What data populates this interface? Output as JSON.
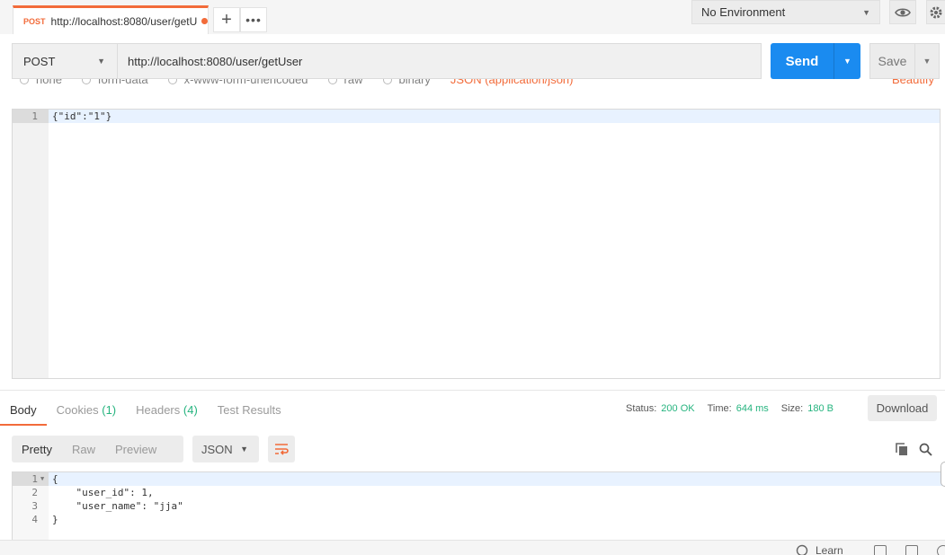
{
  "tab": {
    "method": "POST",
    "url": "http://localhost:8080/user/getU"
  },
  "topbar": {
    "add_label": "+",
    "more_label": "•••"
  },
  "environment": {
    "selected": "No Environment"
  },
  "request": {
    "method": "POST",
    "url": "http://localhost:8080/user/getUser",
    "send_label": "Send",
    "save_label": "Save"
  },
  "body_types": {
    "options": [
      "none",
      "form-data",
      "x-www-form-urlencoded",
      "raw",
      "binary"
    ],
    "selected_type": "JSON (application/json)",
    "beautify_label": "Beautify"
  },
  "request_body": {
    "lines": [
      {
        "n": "1",
        "text": "{\"id\":\"1\"}"
      }
    ]
  },
  "response": {
    "tabs": [
      {
        "label": "Body",
        "count": ""
      },
      {
        "label": "Cookies",
        "count": "(1)"
      },
      {
        "label": "Headers",
        "count": "(4)"
      },
      {
        "label": "Test Results",
        "count": ""
      }
    ],
    "status_label": "Status:",
    "status_value": "200 OK",
    "time_label": "Time:",
    "time_value": "644 ms",
    "size_label": "Size:",
    "size_value": "180 B",
    "download_label": "Download",
    "view_modes": [
      "Pretty",
      "Raw",
      "Preview"
    ],
    "format": "JSON",
    "lines": [
      {
        "n": "1",
        "text": "{"
      },
      {
        "n": "2",
        "text": "    \"user_id\": 1,"
      },
      {
        "n": "3",
        "text": "    \"user_name\": \"jja\""
      },
      {
        "n": "4",
        "text": "}"
      }
    ]
  },
  "statusbar": {
    "learn_label": "Learn"
  },
  "colors": {
    "accent": "#f26b3a",
    "send": "#1a8bf0",
    "success": "#26b47f"
  }
}
